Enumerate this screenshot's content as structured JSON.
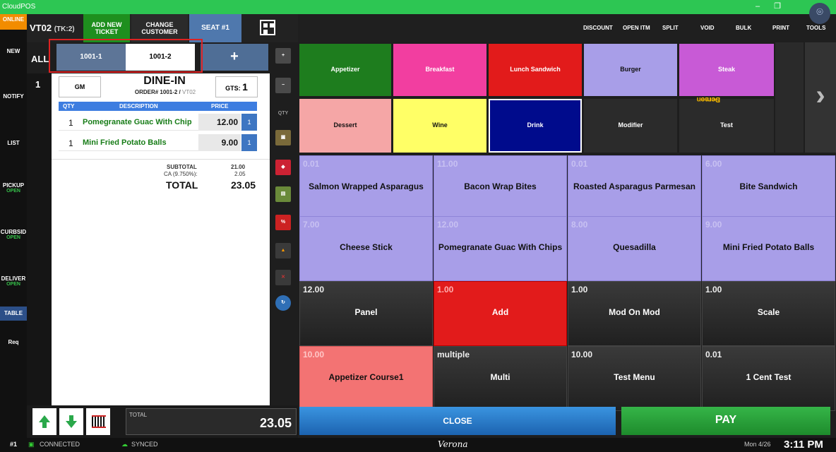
{
  "window": {
    "title": "CloudPOS",
    "minimize": "–",
    "maximize": "❐"
  },
  "nav": {
    "online": "ONLINE",
    "items": [
      {
        "label": "NEW",
        "sub": ""
      },
      {
        "label": "NOTIFY",
        "sub": ""
      },
      {
        "label": "LIST",
        "sub": ""
      },
      {
        "label": "PICKUP",
        "sub": "OPEN"
      },
      {
        "label": "CURBSID",
        "sub": "OPEN"
      },
      {
        "label": "DELIVER",
        "sub": "OPEN"
      },
      {
        "label": "TABLE",
        "sub": ""
      },
      {
        "label": "Req",
        "sub": ""
      }
    ]
  },
  "topbar": {
    "ticket": "VT02",
    "ticket_sub": "(TK:2)",
    "add_ticket": [
      "ADD NEW",
      "TICKET"
    ],
    "change_customer": [
      "CHANGE",
      "CUSTOMER"
    ],
    "seat": "SEAT #1"
  },
  "tabs": {
    "all": "ALL",
    "items": [
      "1001-1",
      "1001-2"
    ],
    "add": "+"
  },
  "seat_number": "1",
  "ticket": {
    "gm": "GM",
    "type": "DINE-IN",
    "order_prefix": "ORDER# 1001-2 / ",
    "order_table": "VT02",
    "gts_label": "GTS:",
    "gts_value": "1",
    "headers": {
      "qty": "QTY",
      "desc": "DESCRIPTION",
      "price": "PRICE"
    },
    "lines": [
      {
        "qty": "1",
        "desc": "Pomegranate Guac With Chip",
        "price": "12.00",
        "seat": "1"
      },
      {
        "qty": "1",
        "desc": "Mini Fried Potato Balls",
        "price": "9.00",
        "seat": "1"
      }
    ],
    "subtotal_label": "SUBTOTAL",
    "subtotal": "21.00",
    "tax_label": "CA (9.750%):",
    "tax": "2.05",
    "total_label": "TOTAL",
    "total": "23.05"
  },
  "bottom": {
    "total_label": "TOTAL",
    "total": "23.05"
  },
  "actions": [
    "DISCOUNT",
    "OPEN ITM",
    "SPLIT",
    "VOID",
    "BULK",
    "PRINT",
    "TOOLS"
  ],
  "categories": [
    {
      "label": "Appetizer",
      "color": "#1e7d1e"
    },
    {
      "label": "Breakfast",
      "color": "#f23ea0"
    },
    {
      "label": "Lunch Sandwich",
      "color": "#e21b1b"
    },
    {
      "label": "Burger",
      "color": "#a89ee8"
    },
    {
      "label": "Steak",
      "color": "#c85ad6"
    },
    {
      "label": "Dessert",
      "color": "#f5a6a6"
    },
    {
      "label": "Wine",
      "color": "#ffff66"
    },
    {
      "label": "Drink",
      "color": "#000b8c"
    },
    {
      "label": "Modifier",
      "color": "#2b2b2b"
    },
    {
      "label": "Test",
      "color": "#2b2b2b"
    }
  ],
  "demo_screen": [
    "Demo",
    "Screen"
  ],
  "menu_items": [
    {
      "price": "0.01",
      "name": "Salmon Wrapped Asparagus"
    },
    {
      "price": "11.00",
      "name": "Bacon Wrap Bites"
    },
    {
      "price": "0.01",
      "name": "Roasted Asparagus Parmesan"
    },
    {
      "price": "6.00",
      "name": "Bite Sandwich"
    },
    {
      "price": "7.00",
      "name": "Cheese Stick"
    },
    {
      "price": "12.00",
      "name": "Pomegranate Guac With Chips"
    },
    {
      "price": "8.00",
      "name": "Quesadilla"
    },
    {
      "price": "9.00",
      "name": "Mini Fried Potato Balls"
    },
    {
      "price": "12.00",
      "name": "Panel"
    },
    {
      "price": "1.00",
      "name": "Add"
    },
    {
      "price": "1.00",
      "name": "Mod On Mod"
    },
    {
      "price": "1.00",
      "name": "Scale"
    },
    {
      "price": "10.00",
      "name": "Appetizer Course1"
    },
    {
      "price": "multiple",
      "name": "Multi"
    },
    {
      "price": "10.00",
      "name": "Test Menu"
    },
    {
      "price": "0.01",
      "name": "1 Cent Test"
    }
  ],
  "buttons": {
    "close": "CLOSE",
    "pay": "PAY"
  },
  "status": {
    "station": "#1",
    "connected": "CONNECTED",
    "synced": "SYNCED",
    "location": "Verona",
    "date": "Mon 4/26",
    "time": "3:11 PM"
  },
  "tools": [
    "QTY"
  ]
}
